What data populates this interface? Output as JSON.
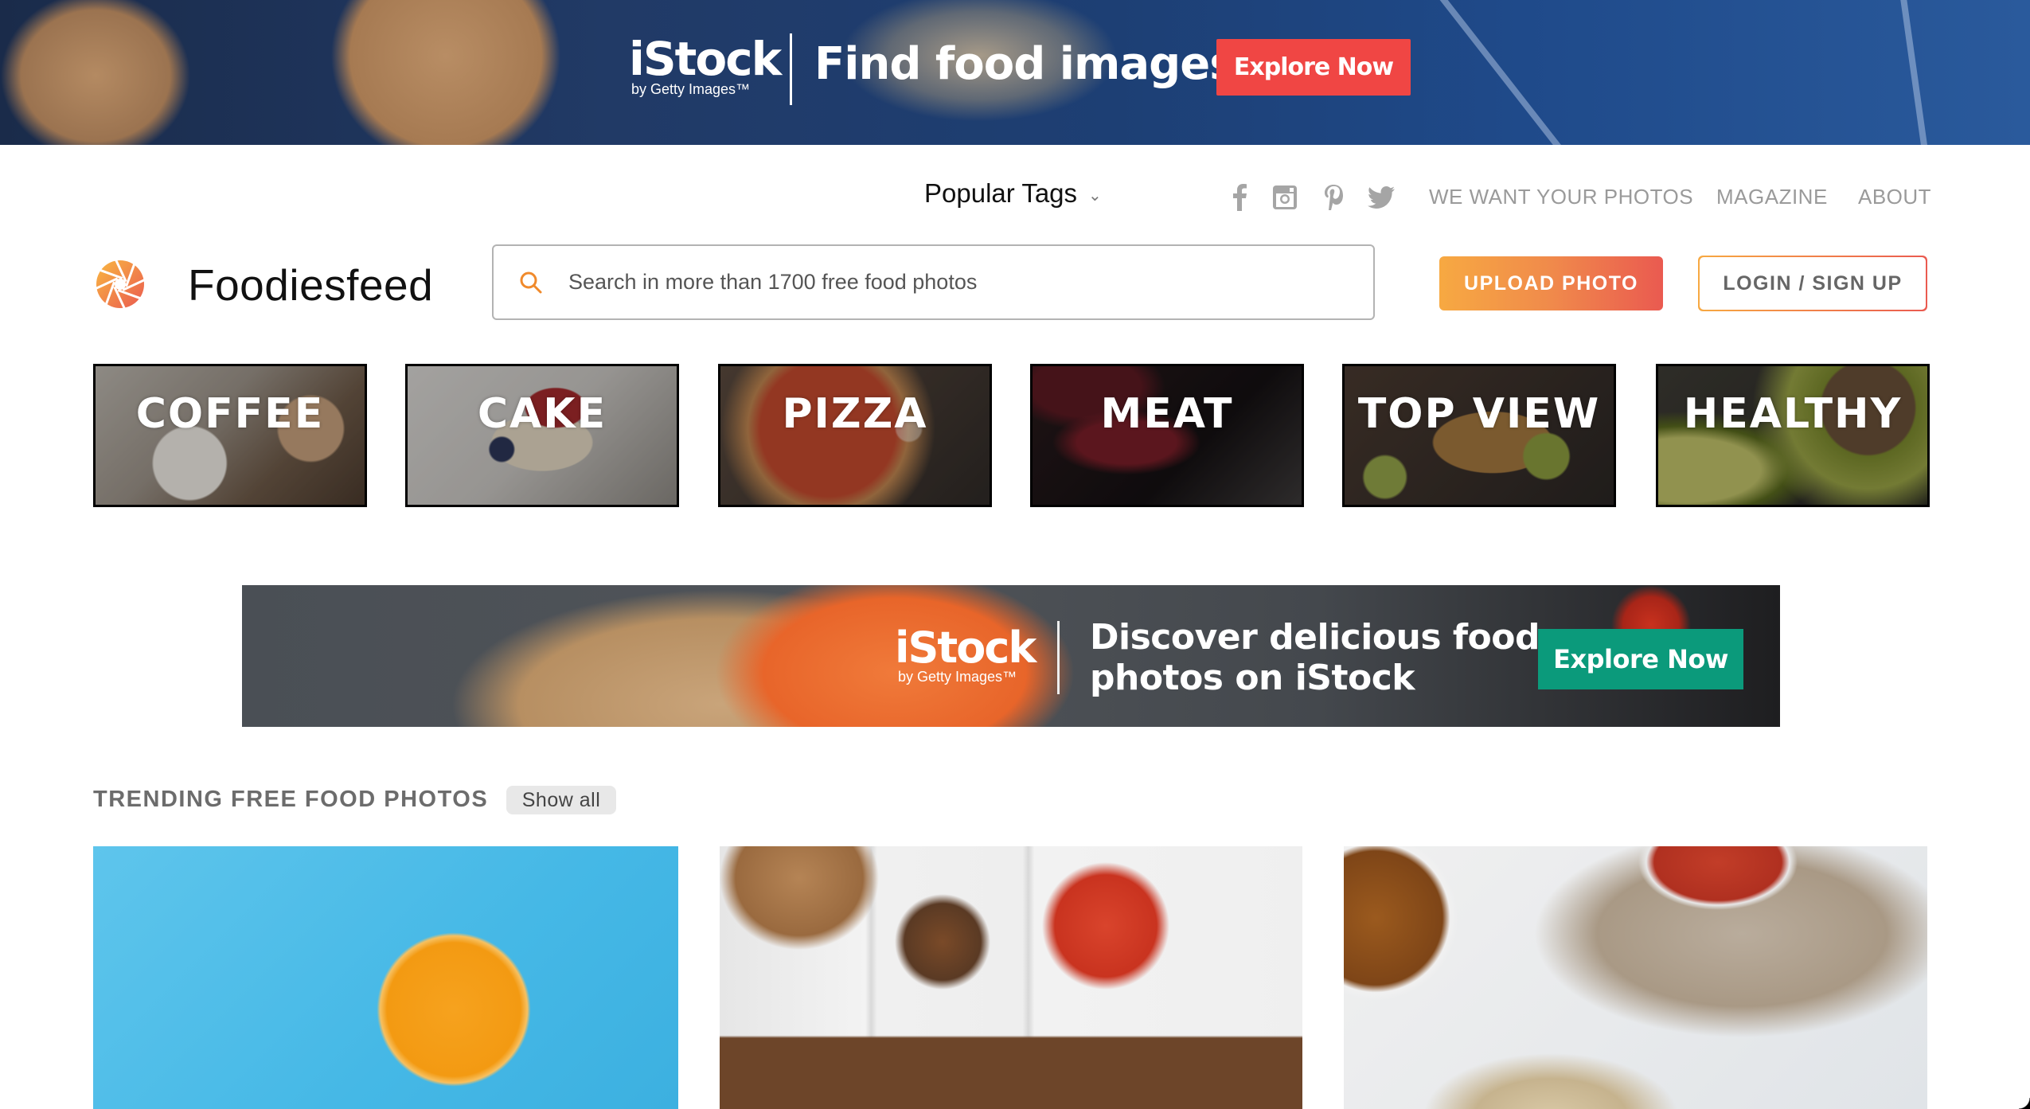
{
  "top_banner": {
    "brand": "iStock",
    "brand_sub": "by Getty Images™",
    "headline": "Find food images",
    "cta_label": "Explore Now",
    "cta_color": "#f04644"
  },
  "top_nav": {
    "popular_tags_label": "Popular Tags",
    "social_icons": [
      "facebook-icon",
      "instagram-icon",
      "pinterest-icon",
      "twitter-icon"
    ],
    "links": [
      "WE WANT YOUR PHOTOS",
      "MAGAZINE",
      "ABOUT"
    ]
  },
  "header": {
    "brand_name": "Foodiesfeed",
    "search": {
      "placeholder": "Search in more than 1700 free food photos",
      "value": ""
    },
    "upload_label": "UPLOAD PHOTO",
    "login_label": "LOGIN / SIGN UP",
    "accent_gradient": [
      "#f7a942",
      "#ea5a50"
    ]
  },
  "categories": [
    {
      "label": "COFFEE"
    },
    {
      "label": "CAKE"
    },
    {
      "label": "PIZZA"
    },
    {
      "label": "MEAT"
    },
    {
      "label": "TOP VIEW"
    },
    {
      "label": "HEALTHY"
    }
  ],
  "mid_banner": {
    "brand": "iStock",
    "brand_sub": "by Getty Images™",
    "headline_line1": "Discover delicious food",
    "headline_line2": "photos on iStock",
    "cta_label": "Explore Now",
    "cta_color": "#0b9a7b"
  },
  "trending": {
    "title": "TRENDING FREE FOOD PHOTOS",
    "show_all_label": "Show all",
    "photos": [
      {
        "subject": "orange half with ice cubes on blue background"
      },
      {
        "subject": "iced drink, tomatoes and garlic on white wooden table"
      },
      {
        "subject": "tea cup, tomatoes bowl and salad plate"
      }
    ]
  }
}
